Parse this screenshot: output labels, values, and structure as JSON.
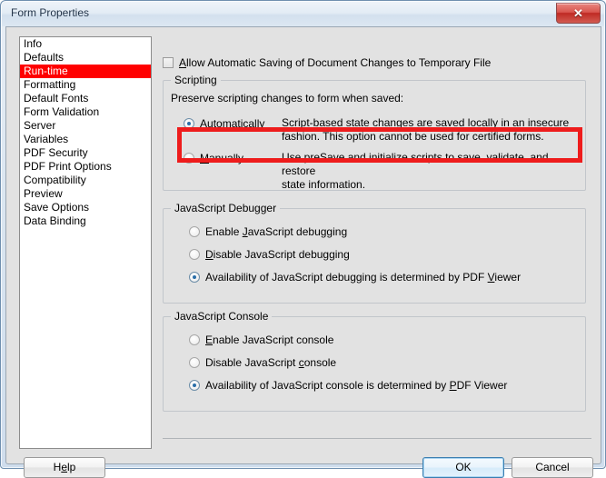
{
  "window": {
    "title": "Form Properties",
    "close_glyph": "✕"
  },
  "sidebar": {
    "items": [
      {
        "label": "Info",
        "selected": false
      },
      {
        "label": "Defaults",
        "selected": false
      },
      {
        "label": "Run-time",
        "selected": true
      },
      {
        "label": "Formatting",
        "selected": false
      },
      {
        "label": "Default Fonts",
        "selected": false
      },
      {
        "label": "Form Validation",
        "selected": false
      },
      {
        "label": "Server",
        "selected": false
      },
      {
        "label": "Variables",
        "selected": false
      },
      {
        "label": "PDF Security",
        "selected": false
      },
      {
        "label": "PDF Print Options",
        "selected": false
      },
      {
        "label": "Compatibility",
        "selected": false
      },
      {
        "label": "Preview",
        "selected": false
      },
      {
        "label": "Save Options",
        "selected": false
      },
      {
        "label": "Data Binding",
        "selected": false
      }
    ]
  },
  "main": {
    "autosave_checkbox": {
      "label_pre": "",
      "label_accel": "A",
      "label_post": "llow Automatic Saving of Document Changes to Temporary File",
      "checked": false
    },
    "scripting": {
      "title": "Scripting",
      "intro": "Preserve scripting changes to form when saved:",
      "options": [
        {
          "accel_pre": "A",
          "accel_letter": "u",
          "accel_post": "tomatically",
          "selected": true,
          "desc_line1": "Script-based state changes are saved locally in an insecure",
          "desc_line2": "fashion. This option cannot be used for certified forms."
        },
        {
          "accel_pre": "",
          "accel_letter": "M",
          "accel_post": "anually",
          "selected": false,
          "desc_line1": "Use preSave and initialize scripts to save, validate, and restore",
          "desc_line2": "state information."
        }
      ]
    },
    "debugger": {
      "title": "JavaScript Debugger",
      "options": [
        {
          "pre": "Enable ",
          "accel": "J",
          "post": "avaScript debugging",
          "selected": false
        },
        {
          "pre": "",
          "accel": "D",
          "post": "isable JavaScript debugging",
          "selected": false
        },
        {
          "pre": "Availability of JavaScript debugging is determined by PDF ",
          "accel": "V",
          "post": "iewer",
          "selected": true
        }
      ]
    },
    "console": {
      "title": "JavaScript Console",
      "options": [
        {
          "pre": "",
          "accel": "E",
          "post": "nable JavaScript console",
          "selected": false
        },
        {
          "pre": "Disable JavaScript ",
          "accel": "c",
          "post": "onsole",
          "selected": false
        },
        {
          "pre": "Availability of JavaScript console is determined by ",
          "accel": "P",
          "post": "DF Viewer",
          "selected": true
        }
      ]
    }
  },
  "footer": {
    "help_pre": "H",
    "help_accel": "e",
    "help_post": "lp",
    "ok_label": "OK",
    "cancel_label": "Cancel"
  },
  "colors": {
    "selection_red": "#ff0000",
    "annotation_red": "#ee1c1c",
    "radio_dot_blue": "#2a6ea8",
    "dialog_background": "#e2e2e2"
  }
}
